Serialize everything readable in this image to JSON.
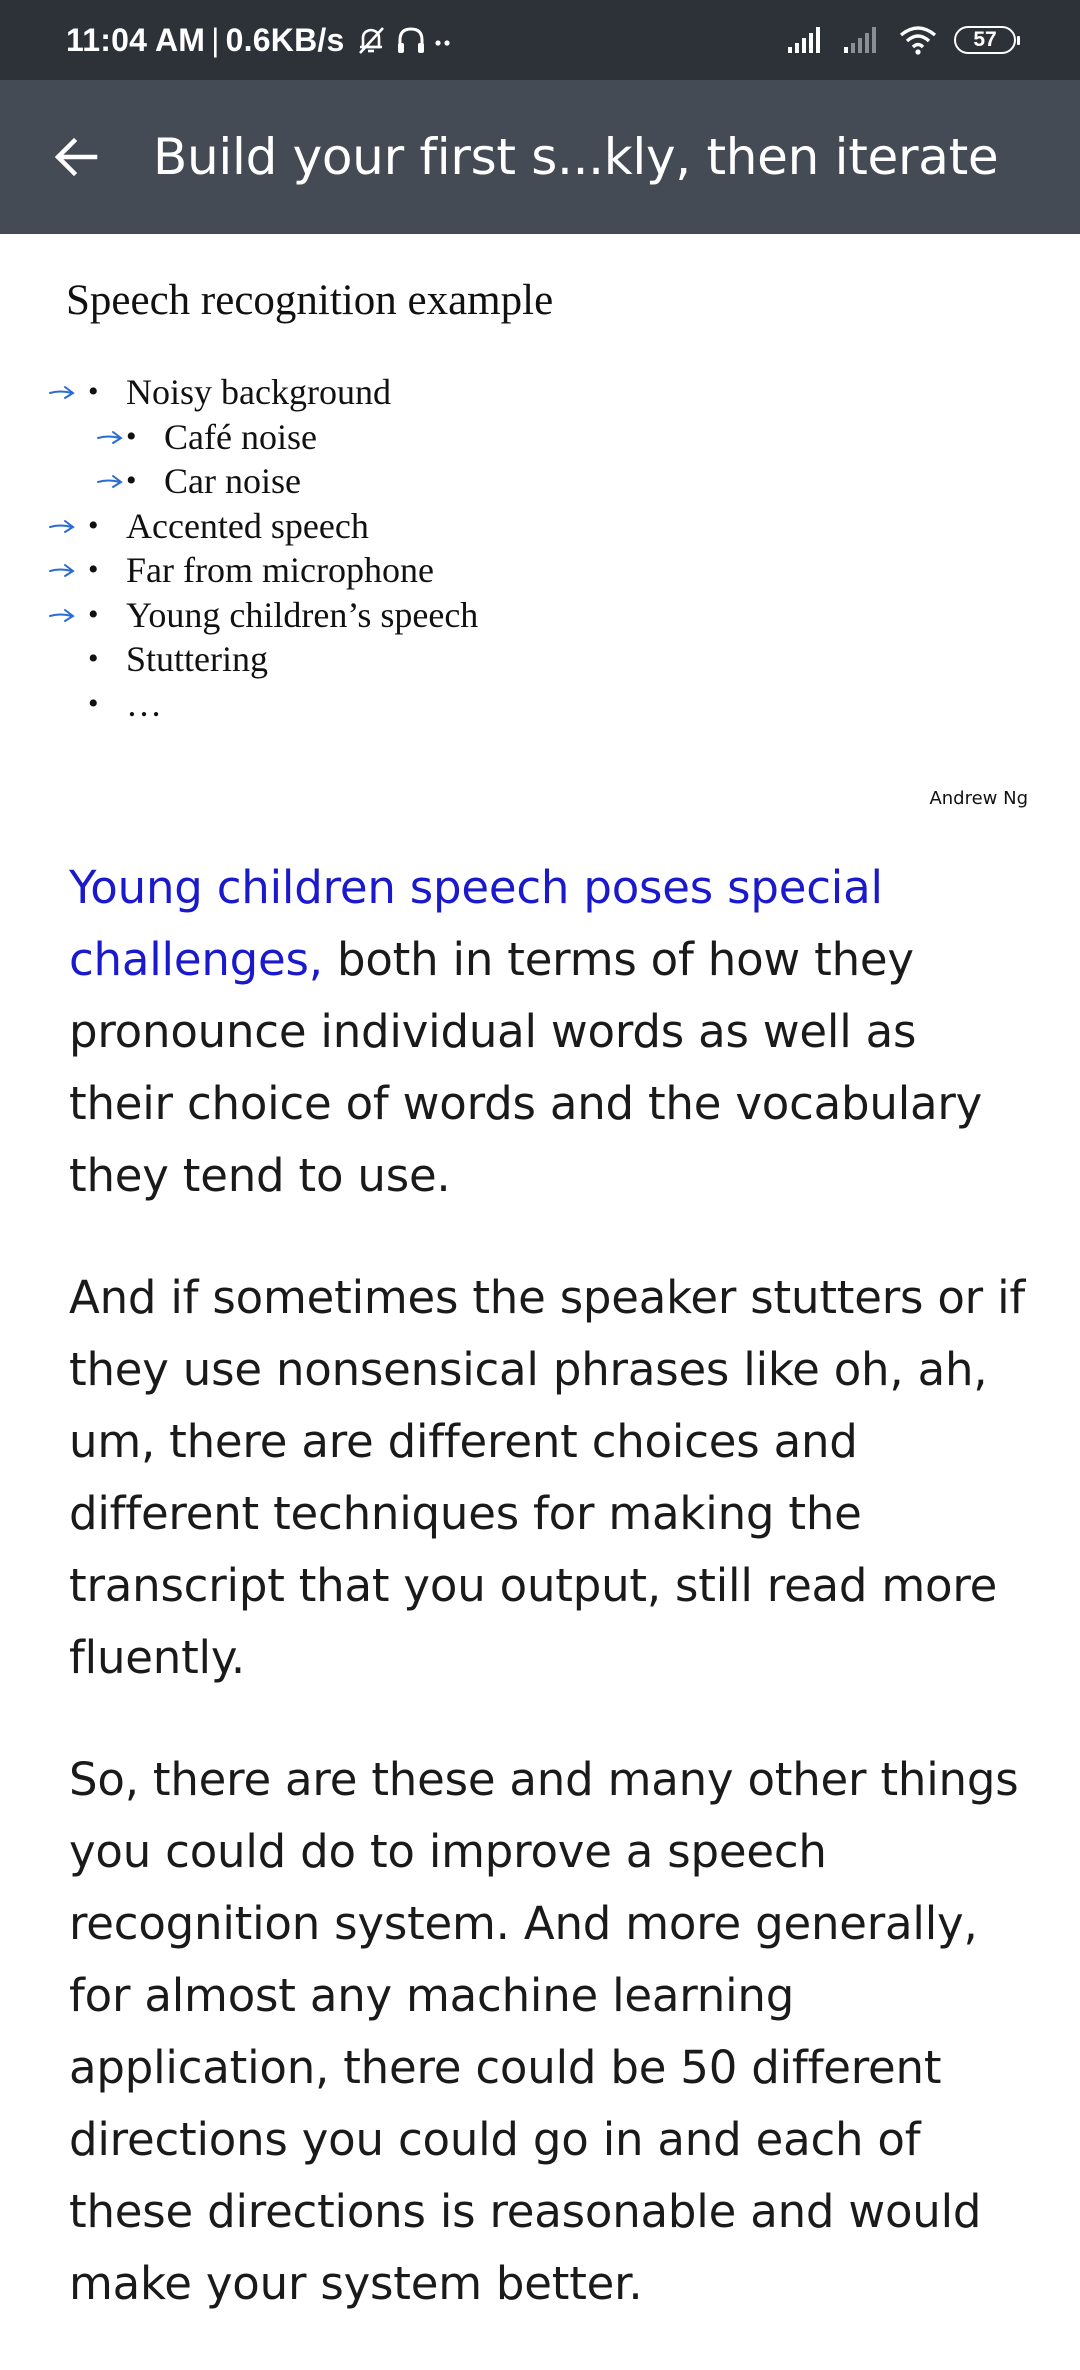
{
  "status_bar": {
    "time": "11:04 AM",
    "separator": "|",
    "network_speed": "0.6KB/s",
    "icons": [
      "mute-icon",
      "headset-icon",
      "more-dots-icon",
      "signal-icon",
      "signal-weak-icon",
      "wifi-icon"
    ],
    "battery": "57"
  },
  "app_bar": {
    "back_icon": "arrow-left-icon",
    "title": "Build your first s...kly, then iterate",
    "background": "#444b54"
  },
  "slide": {
    "title": "Speech recognition example",
    "items": [
      {
        "label": "Noisy background",
        "level": 1,
        "arrow": true
      },
      {
        "label": "Café noise",
        "level": 2,
        "arrow": true
      },
      {
        "label": "Car noise",
        "level": 2,
        "arrow": true
      },
      {
        "label": "Accented speech",
        "level": 1,
        "arrow": true
      },
      {
        "label": "Far from microphone",
        "level": 1,
        "arrow": true
      },
      {
        "label": "Young children’s speech",
        "level": 1,
        "arrow": true
      },
      {
        "label": "Stuttering",
        "level": 1,
        "arrow": false
      },
      {
        "label": "…",
        "level": 1,
        "arrow": false
      }
    ],
    "arrow_color": "#2b6cd4",
    "credit": "Andrew Ng"
  },
  "transcript": {
    "highlight_color": "#1a1acc",
    "paragraphs": [
      {
        "highlight": "Young children speech poses special challenges,",
        "text": " both in terms of how they pronounce individual words as well as their choice of words and the vocabulary they tend to use."
      },
      {
        "highlight": "",
        "text": "And if sometimes the speaker stutters or if they use nonsensical phrases like oh, ah, um, there are different choices and different techniques for making the transcript that you output, still read more fluently."
      },
      {
        "highlight": "",
        "text": "So, there are these and many other things you could do to improve a speech recognition system. And more generally, for almost any machine learning application, there could be 50 different directions you could go in and each of these directions is reasonable and would make your system better."
      }
    ]
  }
}
